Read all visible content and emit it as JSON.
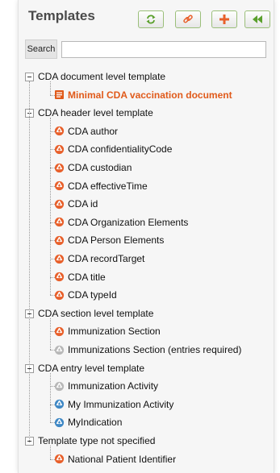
{
  "header": {
    "title": "Templates"
  },
  "toolbar": {
    "buttons": [
      {
        "name": "refresh-button",
        "icon": "refresh-icon"
      },
      {
        "name": "link-button",
        "icon": "link-icon"
      },
      {
        "name": "add-button",
        "icon": "plus-icon"
      },
      {
        "name": "collapse-button",
        "icon": "double-left-arrow-icon"
      }
    ]
  },
  "search": {
    "label": "Search",
    "value": ""
  },
  "colors": {
    "accent_green": "#5aa02c",
    "accent_orange": "#e05a1a",
    "icon_orange": "#e8602b",
    "icon_blue": "#3f88c5",
    "icon_gray": "#b8b8b8"
  },
  "tree": [
    {
      "label": "CDA document level template",
      "children": [
        {
          "label": "Minimal CDA vaccination document",
          "icon": "document-icon",
          "highlight": true
        }
      ]
    },
    {
      "label": "CDA header level template",
      "children": [
        {
          "label": "CDA author",
          "icon": "recycle-orange-icon"
        },
        {
          "label": "CDA confidentialityCode",
          "icon": "recycle-orange-icon"
        },
        {
          "label": "CDA custodian",
          "icon": "recycle-orange-icon"
        },
        {
          "label": "CDA effectiveTime",
          "icon": "recycle-orange-icon"
        },
        {
          "label": "CDA id",
          "icon": "recycle-orange-icon"
        },
        {
          "label": "CDA Organization Elements",
          "icon": "recycle-orange-icon"
        },
        {
          "label": "CDA Person Elements",
          "icon": "recycle-orange-icon"
        },
        {
          "label": "CDA recordTarget",
          "icon": "recycle-orange-icon"
        },
        {
          "label": "CDA title",
          "icon": "recycle-orange-icon"
        },
        {
          "label": "CDA typeId",
          "icon": "recycle-orange-icon"
        }
      ]
    },
    {
      "label": "CDA section level template",
      "children": [
        {
          "label": "Immunization Section",
          "icon": "recycle-orange-icon"
        },
        {
          "label": "Immunizations Section (entries required)",
          "icon": "recycle-gray-icon"
        }
      ]
    },
    {
      "label": "CDA entry level template",
      "children": [
        {
          "label": "Immunization Activity",
          "icon": "recycle-gray-icon"
        },
        {
          "label": "My Immunization Activity",
          "icon": "recycle-blue-icon"
        },
        {
          "label": "MyIndication",
          "icon": "recycle-blue-icon"
        }
      ]
    },
    {
      "label": "Template type not specified",
      "children": [
        {
          "label": "National Patient Identifier",
          "icon": "recycle-orange-icon"
        }
      ]
    }
  ]
}
